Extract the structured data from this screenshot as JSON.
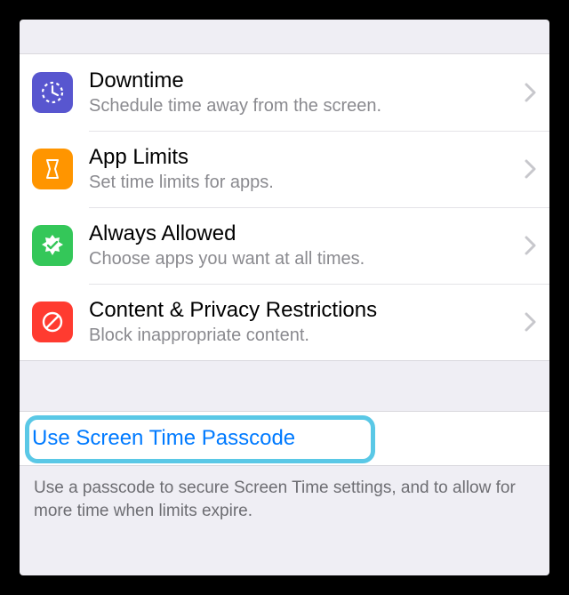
{
  "settings": {
    "items": [
      {
        "title": "Downtime",
        "subtitle": "Schedule time away from the screen.",
        "icon": "downtime-icon"
      },
      {
        "title": "App Limits",
        "subtitle": "Set time limits for apps.",
        "icon": "app-limits-icon"
      },
      {
        "title": "Always Allowed",
        "subtitle": "Choose apps you want at all times.",
        "icon": "always-allowed-icon"
      },
      {
        "title": "Content & Privacy Restrictions",
        "subtitle": "Block inappropriate content.",
        "icon": "content-privacy-icon"
      }
    ]
  },
  "passcode": {
    "action_label": "Use Screen Time Passcode",
    "footer": "Use a passcode to secure Screen Time settings, and to allow for more time when limits expire."
  }
}
